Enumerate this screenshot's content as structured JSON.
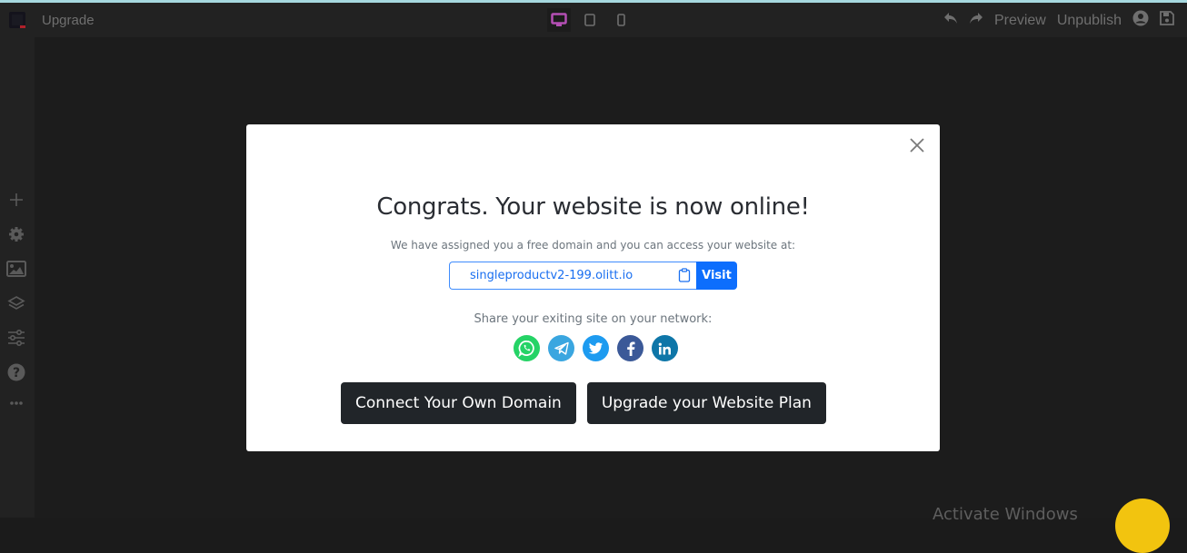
{
  "topbar": {
    "app_title": "Upgrade",
    "devices": [
      {
        "name": "desktop-icon",
        "active": true
      },
      {
        "name": "tablet-icon",
        "active": false
      },
      {
        "name": "mobile-icon",
        "active": false
      }
    ],
    "preview_label": "Preview",
    "unpublish_label": "Unpublish"
  },
  "sidebar": {
    "items": [
      "plus-icon",
      "gear-icon",
      "image-icon",
      "layers-icon",
      "sliders-icon",
      "help-icon",
      "more-icon"
    ]
  },
  "modal": {
    "title": "Congrats. Your website is now online!",
    "subtitle": "We have assigned you a free domain and you can access your website at:",
    "url": "singleproductv2-199.olitt.io",
    "visit_label": "Visit",
    "share_label": "Share your exiting site on your network:",
    "social": [
      {
        "name": "whatsapp",
        "color": "#25d366"
      },
      {
        "name": "telegram",
        "color": "#3aa6e0"
      },
      {
        "name": "twitter",
        "color": "#1d9bf0"
      },
      {
        "name": "facebook",
        "color": "#3b5998"
      },
      {
        "name": "linkedin",
        "color": "#0e76a8"
      }
    ],
    "connect_domain_label": "Connect Your Own Domain",
    "upgrade_plan_label": "Upgrade your Website Plan"
  },
  "watermark": "Activate Windows",
  "colors": {
    "accent": "#0d6efd",
    "active_device": "#b44fb4",
    "help_bubble": "#f2c40f"
  }
}
